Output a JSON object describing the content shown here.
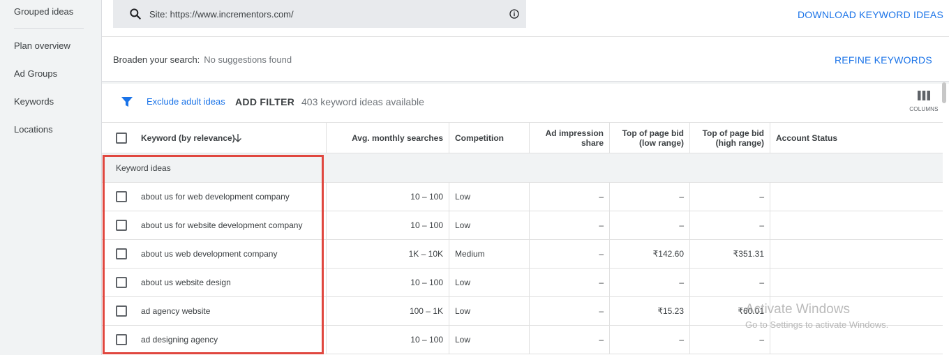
{
  "sidebar": {
    "items": [
      {
        "label": "Grouped ideas"
      },
      {
        "label": "Plan overview"
      },
      {
        "label": "Ad Groups"
      },
      {
        "label": "Keywords"
      },
      {
        "label": "Locations"
      }
    ]
  },
  "search": {
    "value": "Site: https://www.incrementors.com/"
  },
  "toolbar": {
    "download_label": "DOWNLOAD KEYWORD IDEAS",
    "refine_label": "REFINE KEYWORDS"
  },
  "broaden": {
    "label": "Broaden your search:",
    "value": "No suggestions found"
  },
  "filters": {
    "exclude_label": "Exclude adult ideas",
    "add_filter_label": "ADD FILTER",
    "count_text": "403 keyword ideas available",
    "columns_label": "COLUMNS"
  },
  "table": {
    "headers": {
      "keyword": "Keyword (by relevance)",
      "searches": "Avg. monthly searches",
      "competition": "Competition",
      "impression_1": "Ad impression",
      "impression_2": "share",
      "bid_low_1": "Top of page bid",
      "bid_low_2": "(low range)",
      "bid_high_1": "Top of page bid",
      "bid_high_2": "(high range)",
      "status": "Account Status"
    },
    "group_label": "Keyword ideas",
    "rows": [
      {
        "keyword": "about us for web development company",
        "searches": "10 – 100",
        "competition": "Low",
        "impression": "–",
        "bid_low": "–",
        "bid_high": "–"
      },
      {
        "keyword": "about us for website development company",
        "searches": "10 – 100",
        "competition": "Low",
        "impression": "–",
        "bid_low": "–",
        "bid_high": "–"
      },
      {
        "keyword": "about us web development company",
        "searches": "1K – 10K",
        "competition": "Medium",
        "impression": "–",
        "bid_low": "₹142.60",
        "bid_high": "₹351.31"
      },
      {
        "keyword": "about us website design",
        "searches": "10 – 100",
        "competition": "Low",
        "impression": "–",
        "bid_low": "–",
        "bid_high": "–"
      },
      {
        "keyword": "ad agency website",
        "searches": "100 – 1K",
        "competition": "Low",
        "impression": "–",
        "bid_low": "₹15.23",
        "bid_high": "₹60.01"
      },
      {
        "keyword": "ad designing agency",
        "searches": "10 – 100",
        "competition": "Low",
        "impression": "–",
        "bid_low": "–",
        "bid_high": "–"
      }
    ]
  },
  "watermark": {
    "line1": "Activate Windows",
    "line2": "Go to Settings to activate Windows."
  },
  "colors": {
    "accent": "#1a73e8",
    "highlight": "#e0473f"
  }
}
